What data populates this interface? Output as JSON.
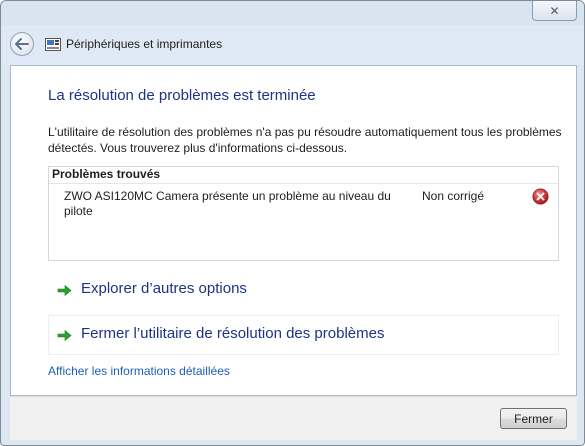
{
  "window": {
    "close_glyph": "✕"
  },
  "nav": {
    "title": "Périphériques et imprimantes"
  },
  "main": {
    "heading": "La résolution de problèmes est terminée",
    "description": "L'utilitaire de résolution des problèmes n'a pas pu résoudre automatiquement tous les problèmes détectés. Vous trouverez plus d'informations ci-dessous.",
    "problems": {
      "header": "Problèmes trouvés",
      "items": [
        {
          "text": "ZWO ASI120MC Camera présente un problème au niveau du pilote",
          "status": "Non corrigé",
          "icon": "error-icon"
        }
      ]
    },
    "options": [
      {
        "label": "Explorer d’autres options",
        "icon": "green-arrow-icon"
      },
      {
        "label": "Fermer l’utilitaire de résolution des problèmes",
        "icon": "green-arrow-icon"
      }
    ],
    "details_link": "Afficher les informations détaillées"
  },
  "footer": {
    "close_label": "Fermer"
  },
  "colors": {
    "heading": "#1e3287",
    "link": "#1f5fb8",
    "arrow": "#2f9e2f",
    "error": "#c0262a"
  }
}
